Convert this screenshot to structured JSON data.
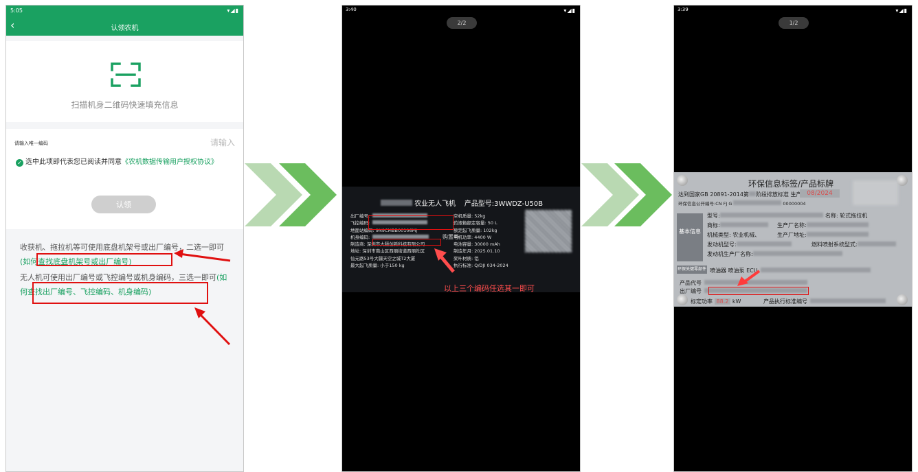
{
  "phone1": {
    "status_time": "5:05",
    "status_icons": "▾◢▮",
    "nav_title": "认领农机",
    "scan_hint": "扫描机身二维码快速填充信息",
    "form_label": "请输入唯一编码",
    "input_placeholder": "请输入",
    "agree_prefix": "选中此项即代表您已阅读并同意",
    "agree_link": "《农机数据传输用户授权协议》",
    "claim_button": "认领",
    "help1_text": "收获机、拖拉机等可使用底盘机架号或出厂编号，二选一即可",
    "help1_link": "(如何查找底盘机架号或出厂编号)",
    "help2_text": "无人机可使用出厂编号或飞控编号或机身编码，三选一即可",
    "help2_link": "(如何查找出厂编号、飞控编码、机身编码)",
    "accent": "#1aa161",
    "highlight": "#e01010"
  },
  "phone2": {
    "status_time": "3:40",
    "status_icons": "▾◢▮",
    "pager": "2/2",
    "plate_title_suffix": "农业无人飞机",
    "plate_model": "产品型号:3WWDZ-U50B",
    "left_col": [
      "出厂编号:",
      "飞控编码:",
      "地面站编码: 9N9CMBB00106MJ",
      "机身编码:",
      "制造商: 深圳市大疆创新科技有限公司",
      "地址: 深圳市南山区西丽街道西丽社区",
      "仙元路53号大疆天空之城T2大厦",
      "最大起飞质量: 小于150 kg"
    ],
    "right_col": [
      "空机质量: 52kg",
      "药液箱额定容量: 50 L",
      "额定起飞质量: 102kg",
      "电机功率: 4400 W",
      "电池容量: 30000 mAh",
      "制造年月: 2025.01.10",
      "桨叶材质: 铝",
      "执行标准: Q/DJI 034-2024"
    ],
    "overlay_text": "购置号",
    "caption": "以上三个编码任选其一即可"
  },
  "phone3": {
    "status_time": "3:39",
    "status_icons": "▾◢▮",
    "pager": "1/2",
    "plate_title": "环保信息标签/产品标牌",
    "row_standard": "达到国家GB 20891-2014第",
    "row_standard_tail": "阶段排放标准  生产日期",
    "production_date": "08/2024",
    "row_env_code": "环保信息公开编号:CN FJ G",
    "env_code_tail": "00000004",
    "row_model": "型号:",
    "row_name": "名称: 轮式拖拉机",
    "row_brand": "商标:",
    "row_maker": "生产厂名称:",
    "row_type": "机械类型: 农业机械、",
    "row_addr": "生产厂地址:",
    "row_engine_model": "发动机型号:",
    "row_fuel": "燃料喷射系统型式:",
    "row_engine_maker": "发动机生产厂名称:",
    "basic_label": "基本信息",
    "row_env_parts": "环保关键零部件",
    "row_injector": "喷油器  喷油泵  ECU",
    "row_product_code": "产品代号",
    "row_serial": "出厂编号",
    "row_power": "标定功率",
    "power_value": "88.2",
    "power_unit": "kW",
    "row_exec_std": "产品执行标准编号"
  }
}
